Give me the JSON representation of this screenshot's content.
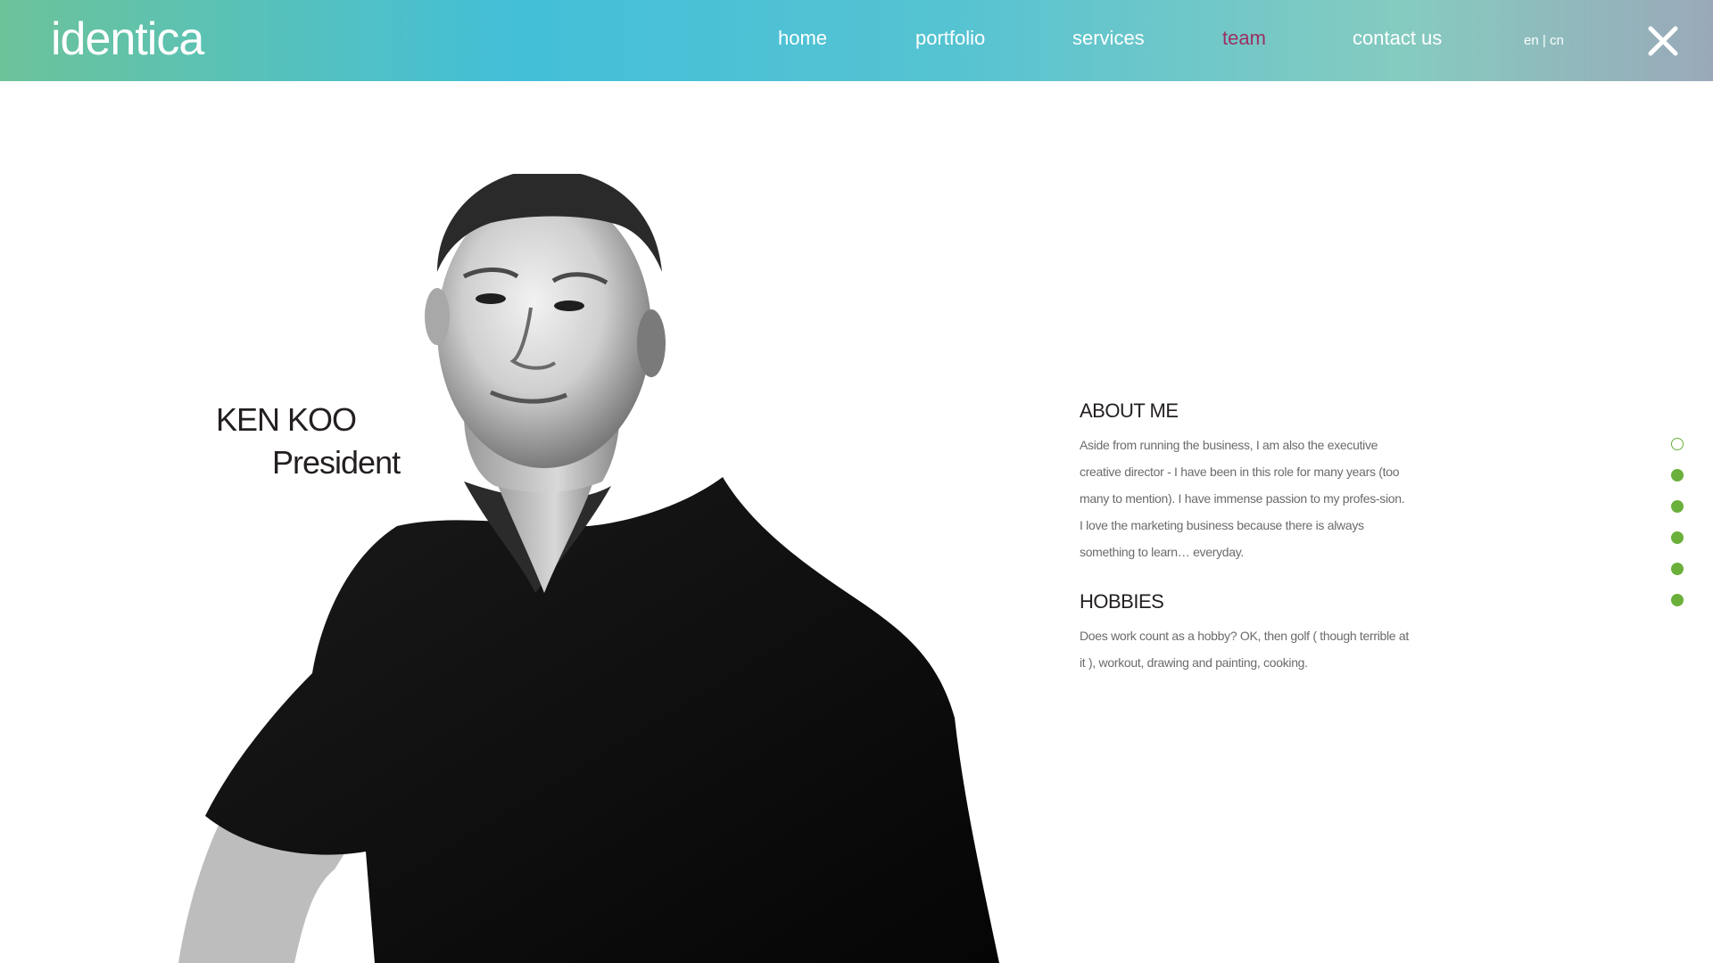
{
  "header": {
    "logo": "identica",
    "nav": [
      {
        "label": "home",
        "active": false
      },
      {
        "label": "portfolio",
        "active": false
      },
      {
        "label": "services",
        "active": false
      },
      {
        "label": "team",
        "active": true
      },
      {
        "label": "contact us",
        "active": false
      }
    ],
    "lang": {
      "en": "en",
      "separator": "|",
      "cn": "cn"
    },
    "close_icon": "close-x-icon"
  },
  "profile": {
    "name": "KEN KOO",
    "role": "President",
    "about_title": "ABOUT ME",
    "about_text": "Aside from running the business, I am also the executive creative director - I have been in this role for many years (too many to mention). I have immense passion to my profes-sion. I love the marketing business because there is always something to learn… everyday.",
    "hobbies_title": "HOBBIES",
    "hobbies_text": "Does work count as a hobby? OK, then golf ( though terrible at it ), workout, drawing and painting, cooking."
  },
  "pagination": {
    "dots": [
      {
        "active": false
      },
      {
        "active": true
      },
      {
        "active": true
      },
      {
        "active": true
      },
      {
        "active": true
      },
      {
        "active": true
      }
    ]
  },
  "colors": {
    "accent_nav_active": "#9c2f63",
    "dot_green": "#6ab03b",
    "header_gradient": [
      "#6cc39a",
      "#43bfd8",
      "#85cbc0",
      "#9aa9b9"
    ]
  }
}
